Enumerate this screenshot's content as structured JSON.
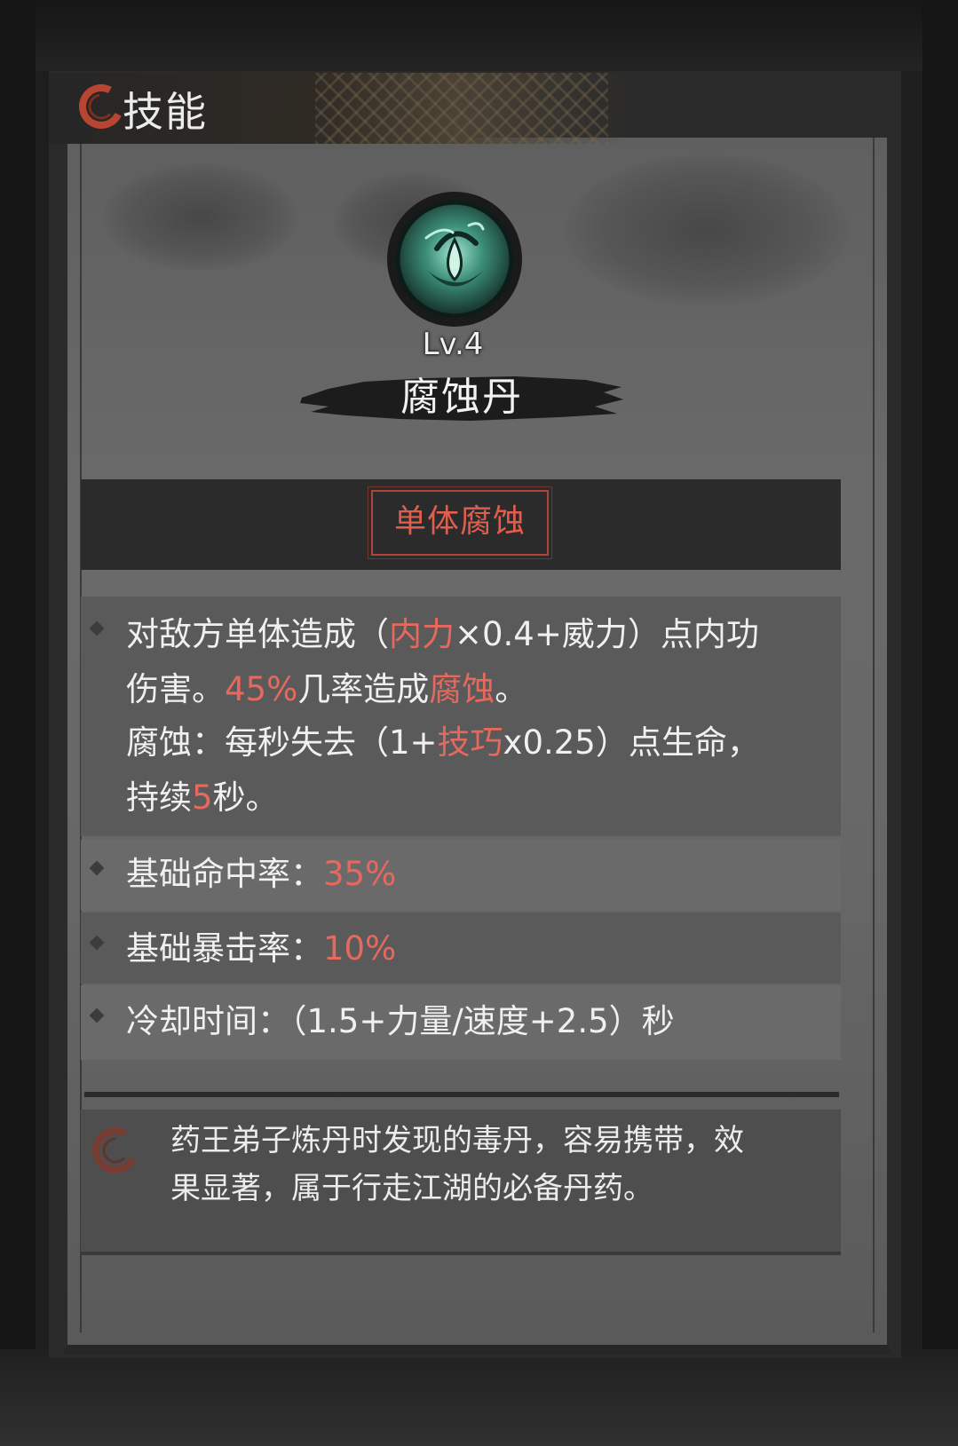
{
  "header": {
    "title": "技能"
  },
  "skill": {
    "level": "Lv.4",
    "name": "腐蚀丹",
    "tag": "单体腐蚀"
  },
  "description_block": {
    "line1": {
      "a": "对敌方单体造成（",
      "b": "内力",
      "c": "×0.4+威力）点内功"
    },
    "line2": {
      "a": "伤害。",
      "b": "45%",
      "c": "几率造成",
      "d": "腐蚀",
      "e": "。"
    },
    "line3": {
      "a": "腐蚀：每秒失去（1+",
      "b": "技巧",
      "c": "x0.25）点生命，"
    },
    "line4": {
      "a": "持续",
      "b": "5",
      "c": "秒。"
    }
  },
  "stats": {
    "hit_label": "基础命中率：",
    "hit_value": "35%",
    "crit_label": "基础暴击率：",
    "crit_value": "10%",
    "cooldown_label": "冷却时间：",
    "cooldown_value": "（1.5+力量/速度+2.5）秒"
  },
  "lore": {
    "line1": "药王弟子炼丹时发现的毒丹，容易携带，效",
    "line2": "果显著，属于行走江湖的必备丹药。"
  },
  "colors": {
    "accent_red": "#e7685c",
    "tag_border": "#b04436",
    "skill_icon_green": "#4fa58f"
  }
}
